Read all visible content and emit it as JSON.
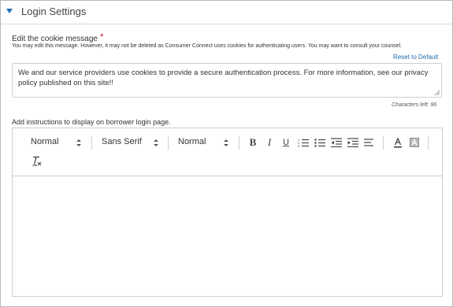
{
  "section": {
    "title": "Login Settings"
  },
  "cookie_message": {
    "label": "Edit the cookie message",
    "required_mark": "*",
    "hint": "You may edit this message. However, it may not be deleted as Consumer Connect uses cookies for authenticating users. You may want to consult your counsel.",
    "reset_label": "Reset to Default",
    "value": "We and our service providers use cookies to provide a secure authentication process. For more information, see our privacy policy published on this site!!",
    "chars_left": "Characters left: 96"
  },
  "instructions": {
    "label": "Add instructions to display on borrower login page.",
    "toolbar": {
      "header_select": "Normal",
      "font_select": "Sans Serif",
      "size_select": "Normal"
    },
    "content": ""
  },
  "icons": {
    "collapse": "caret-down-icon",
    "bold": "bold-icon",
    "italic": "italic-icon",
    "underline": "underline-icon",
    "ordered_list": "ordered-list-icon",
    "bullet_list": "bullet-list-icon",
    "outdent": "outdent-icon",
    "indent": "indent-icon",
    "align": "align-left-icon",
    "text_color": "text-color-icon",
    "background_color": "background-color-icon",
    "clear_format": "clear-formatting-icon"
  },
  "colors": {
    "accent": "#1f6fb2",
    "required": "#d0021b",
    "border": "#cfcfcf"
  }
}
